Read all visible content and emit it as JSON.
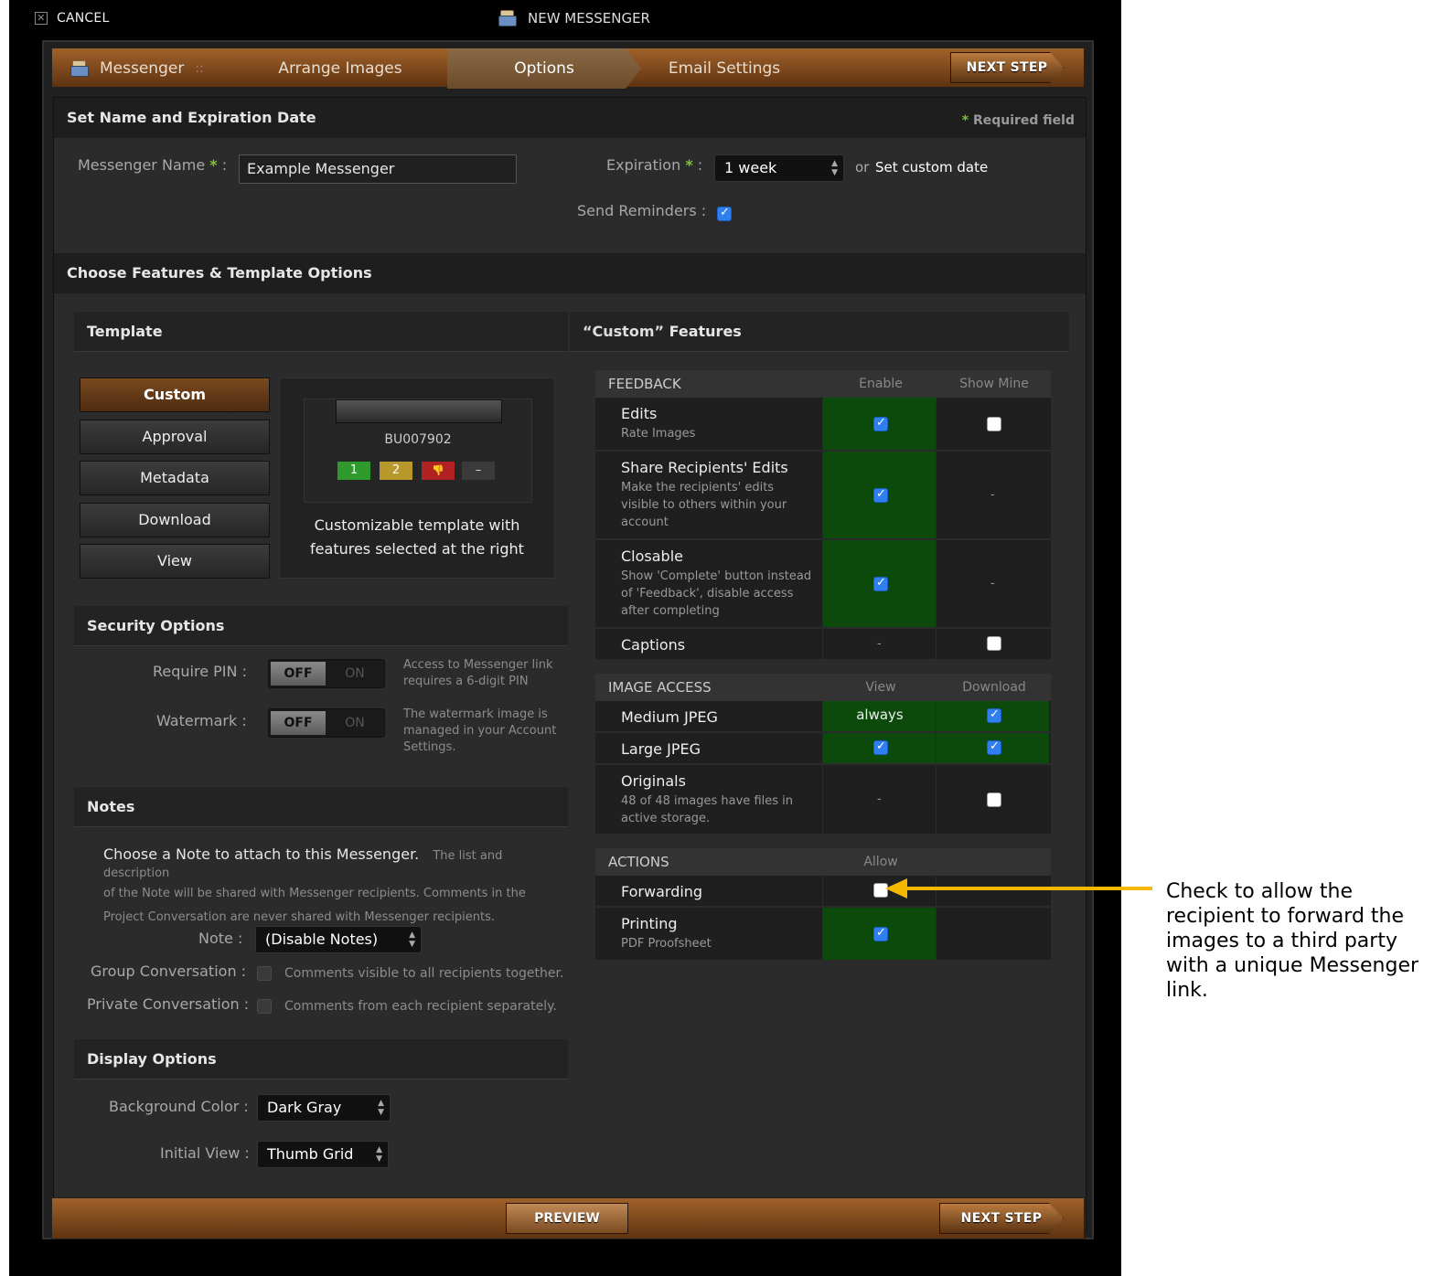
{
  "topbar": {
    "cancel": "CANCEL",
    "title": "NEW MESSENGER"
  },
  "wizard": {
    "steps": [
      "Messenger",
      "Arrange Images",
      "Options",
      "Email Settings"
    ],
    "sep": "::",
    "next": "NEXT STEP"
  },
  "section1": {
    "title": "Set Name and Expiration Date",
    "required_star": "*",
    "required_text": "Required field",
    "name_label": "Messenger Name",
    "name_value": "Example Messenger",
    "expiration_label": "Expiration",
    "expiration_value": "1 week",
    "or": "or",
    "custom_date": "Set custom date",
    "reminders_label": "Send Reminders :",
    "colon": ":"
  },
  "section2": {
    "title": "Choose Features & Template Options"
  },
  "template": {
    "title": "Template",
    "buttons": [
      "Custom",
      "Approval",
      "Metadata",
      "Download",
      "View"
    ],
    "preview_id": "BU007902",
    "ratings": [
      "1",
      "2",
      "👎",
      "–"
    ],
    "description_line1": "Customizable template with",
    "description_line2": "features selected at the right"
  },
  "features": {
    "title_q1": "“Custom”",
    "title_rest": "Features"
  },
  "security": {
    "title": "Security Options",
    "pin_label": "Require PIN :",
    "watermark_label": "Watermark :",
    "off": "OFF",
    "on": "ON",
    "pin_help": "Access to Messenger link requires a 6-digit PIN",
    "watermark_help": "The watermark image is managed in your Account Settings."
  },
  "notes": {
    "title": "Notes",
    "lead": "Choose a Note to attach to this Messenger.",
    "help_1": "The list and description",
    "help_2": "of the Note will be shared with Messenger recipients. Comments in the",
    "help_3": "Project Conversation are never shared with Messenger recipients.",
    "note_label": "Note :",
    "note_value": "(Disable Notes)",
    "group_label": "Group Conversation :",
    "group_help": "Comments visible to all recipients together.",
    "private_label": "Private Conversation :",
    "private_help": "Comments from each recipient separately."
  },
  "display": {
    "title": "Display Options",
    "bg_label": "Background Color :",
    "bg_value": "Dark Gray",
    "view_label": "Initial View :",
    "view_value": "Thumb Grid"
  },
  "feedback": {
    "header": "FEEDBACK",
    "col1": "Enable",
    "col2": "Show Mine",
    "edits": "Edits",
    "edits_sub": "Rate Images",
    "share": "Share Recipients' Edits",
    "share_sub1": "Make the recipients' edits",
    "share_sub2": "visible to others within your",
    "share_sub3": "account",
    "closable": "Closable",
    "closable_sub1": "Show 'Complete' button instead",
    "closable_sub2": "of 'Feedback', disable access",
    "closable_sub3": "after completing",
    "captions": "Captions",
    "dash": "-"
  },
  "image_access": {
    "header": "IMAGE ACCESS",
    "col1": "View",
    "col2": "Download",
    "medium": "Medium JPEG",
    "always": "always",
    "large": "Large JPEG",
    "originals": "Originals",
    "originals_sub1": "48 of 48 images have files in",
    "originals_sub2": "active storage."
  },
  "actions": {
    "header": "ACTIONS",
    "col1": "Allow",
    "forwarding": "Forwarding",
    "printing": "Printing",
    "printing_sub": "PDF Proofsheet"
  },
  "footer": {
    "preview": "PREVIEW",
    "next": "NEXT STEP"
  },
  "annotation": "Check to allow the recipient to forward the images to a third party with a unique Messenger link.",
  "colors": {
    "accent_green": "#0b4a0b",
    "checkbox_blue": "#2f7ff0",
    "arrow": "#f5b800",
    "required_star": "#7ec43a"
  }
}
